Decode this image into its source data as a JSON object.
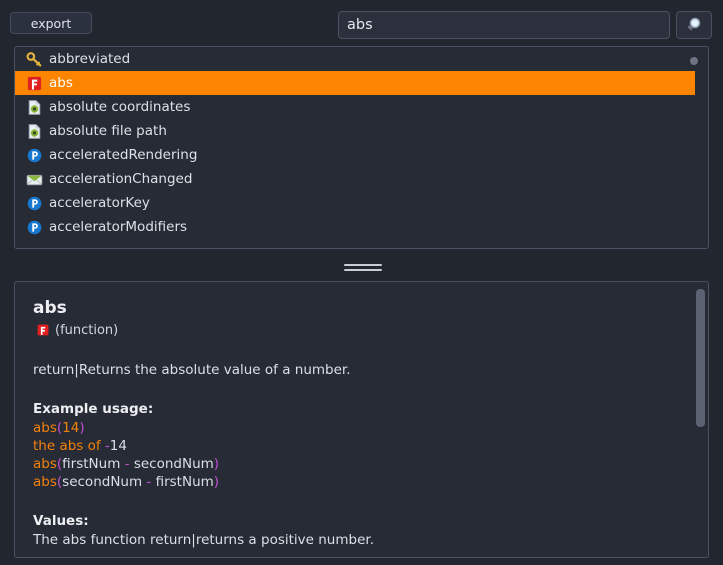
{
  "toolbar": {
    "export_label": "export",
    "search_value": "abs",
    "search_placeholder": "",
    "search_button_icon": "magnifier-icon"
  },
  "colors": {
    "page_background": "#22262f",
    "panel_background": "#272b35",
    "panel_border": "#4a5163",
    "selection": "#fb8500",
    "text": "#dcdfe6",
    "code_function": "#f2820c",
    "code_paren": "#c14fd4",
    "icon_function_red": "#e02020",
    "icon_property_blue": "#1878d0",
    "icon_key_gold": "#e3b23c",
    "icon_green": "#8cb840"
  },
  "results_list": {
    "selected_index": 1,
    "items": [
      {
        "label": "abbreviated",
        "icon": "key-icon"
      },
      {
        "label": "abs",
        "icon": "function-icon"
      },
      {
        "label": "absolute coordinates",
        "icon": "document-icon"
      },
      {
        "label": "absolute file path",
        "icon": "document-icon"
      },
      {
        "label": "acceleratedRendering",
        "icon": "property-icon"
      },
      {
        "label": "accelerationChanged",
        "icon": "event-icon"
      },
      {
        "label": "acceleratorKey",
        "icon": "property-icon"
      },
      {
        "label": "acceleratorModifiers",
        "icon": "property-icon"
      }
    ]
  },
  "splitter": {
    "handle_icon": "splitter-grip-icon"
  },
  "detail": {
    "title": "abs",
    "kind_icon": "function-icon",
    "kind_label": "(function)",
    "summary": "return|Returns the absolute value of a number.",
    "example_heading": "Example usage:",
    "examples": [
      [
        {
          "t": "abs",
          "c": "fn"
        },
        {
          "t": "(",
          "c": "paren"
        },
        {
          "t": "14",
          "c": "num"
        },
        {
          "t": ")",
          "c": "paren"
        }
      ],
      [
        {
          "t": "the abs of ",
          "c": "text"
        },
        {
          "t": "-",
          "c": "op"
        },
        {
          "t": "14",
          "c": "var"
        }
      ],
      [
        {
          "t": "abs",
          "c": "fn"
        },
        {
          "t": "(",
          "c": "paren"
        },
        {
          "t": "firstNum ",
          "c": "var"
        },
        {
          "t": "-",
          "c": "op"
        },
        {
          "t": " secondNum",
          "c": "var"
        },
        {
          "t": ")",
          "c": "paren"
        }
      ],
      [
        {
          "t": "abs",
          "c": "fn"
        },
        {
          "t": "(",
          "c": "paren"
        },
        {
          "t": "secondNum ",
          "c": "var"
        },
        {
          "t": "-",
          "c": "op"
        },
        {
          "t": " firstNum",
          "c": "var"
        },
        {
          "t": ")",
          "c": "paren"
        }
      ]
    ],
    "values_heading": "Values:",
    "values_text": "The abs function return|returns a positive number."
  }
}
